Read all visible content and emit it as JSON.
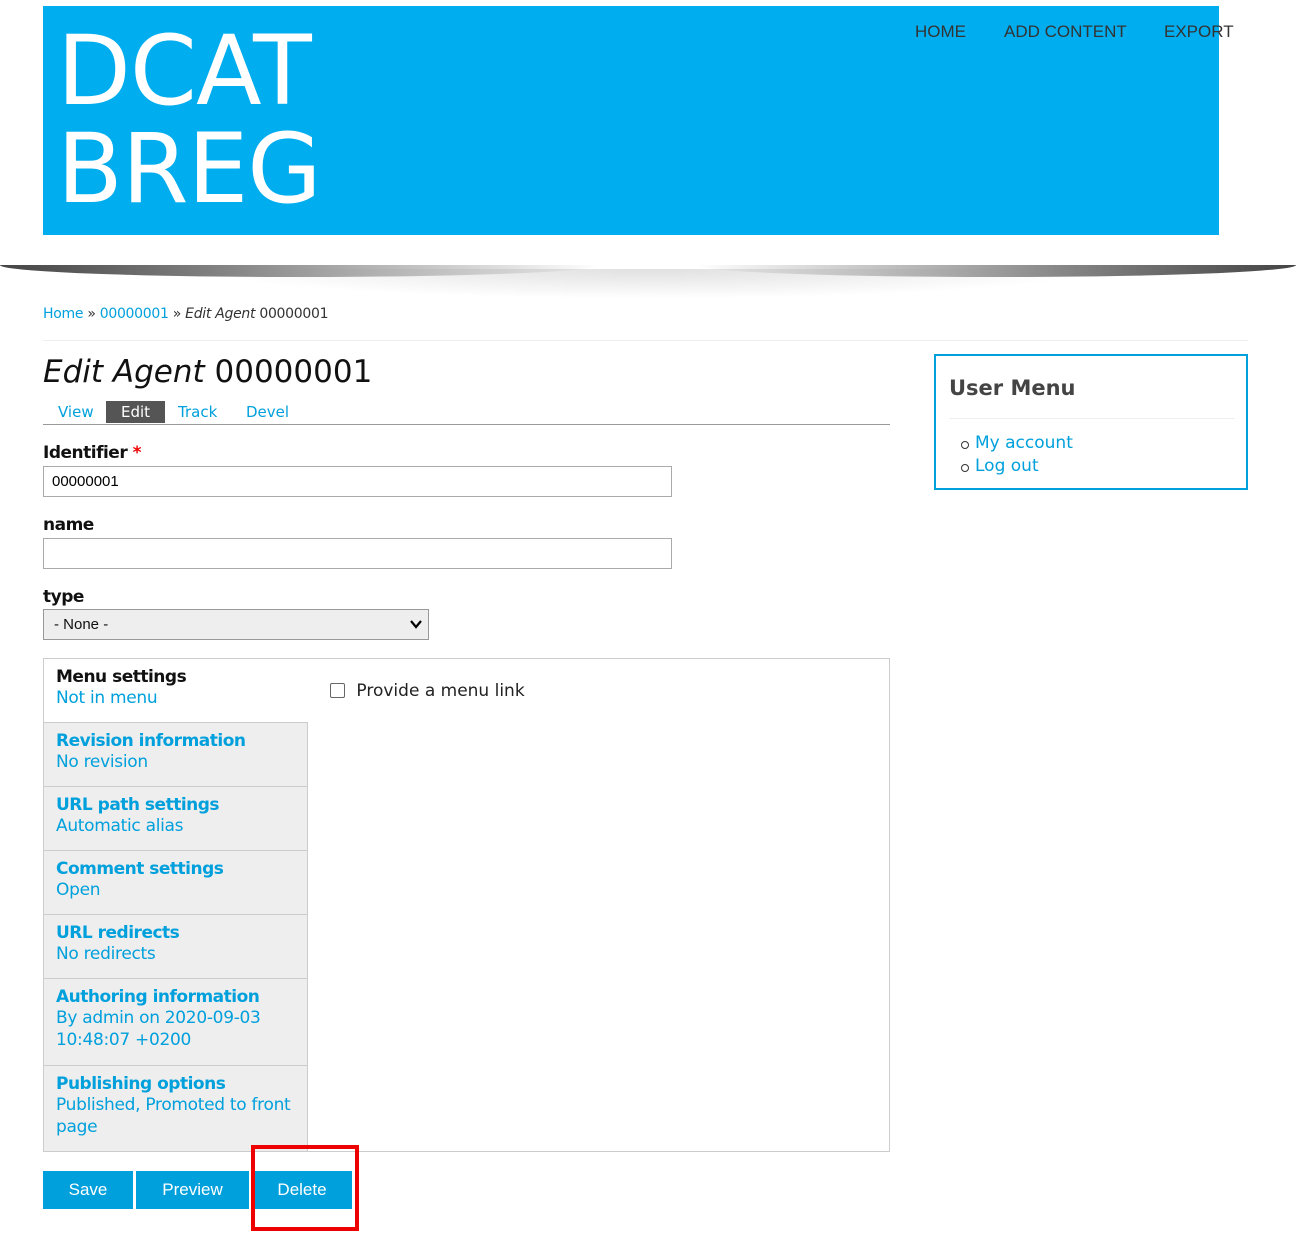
{
  "header": {
    "site_name_line1": "DCAT",
    "site_name_line2": "BREG",
    "nav": [
      "HOME",
      "ADD CONTENT",
      "EXPORT"
    ]
  },
  "breadcrumb": {
    "home": "Home",
    "sep1": "»",
    "item": "00000001",
    "sep2": "»",
    "current_em": "Edit Agent",
    "current_id": "00000001"
  },
  "page": {
    "title_em": "Edit Agent",
    "title_id": "00000001"
  },
  "tabs": [
    "View",
    "Edit",
    "Track",
    "Devel"
  ],
  "form": {
    "identifier_label": "Identifier",
    "required_mark": "*",
    "identifier_value": "00000001",
    "name_label": "name",
    "name_value": "",
    "type_label": "type",
    "type_value": "- None -"
  },
  "vertical_tabs": [
    {
      "title": "Menu settings",
      "summary": "Not in menu"
    },
    {
      "title": "Revision information",
      "summary": "No revision"
    },
    {
      "title": "URL path settings",
      "summary": "Automatic alias"
    },
    {
      "title": "Comment settings",
      "summary": "Open"
    },
    {
      "title": "URL redirects",
      "summary": "No redirects"
    },
    {
      "title": "Authoring information",
      "summary": "By admin on 2020-09-03 10:48:07 +0200"
    },
    {
      "title": "Publishing options",
      "summary": "Published, Promoted to front page"
    }
  ],
  "menu_pane": {
    "checkbox_label": "Provide a menu link"
  },
  "buttons": {
    "save": "Save",
    "preview": "Preview",
    "delete": "Delete"
  },
  "sidebar": {
    "title": "User Menu",
    "items": [
      "My account",
      "Log out"
    ]
  },
  "colors": {
    "brand": "#00adef",
    "link": "#00a0dc",
    "highlight": "#e00000"
  }
}
